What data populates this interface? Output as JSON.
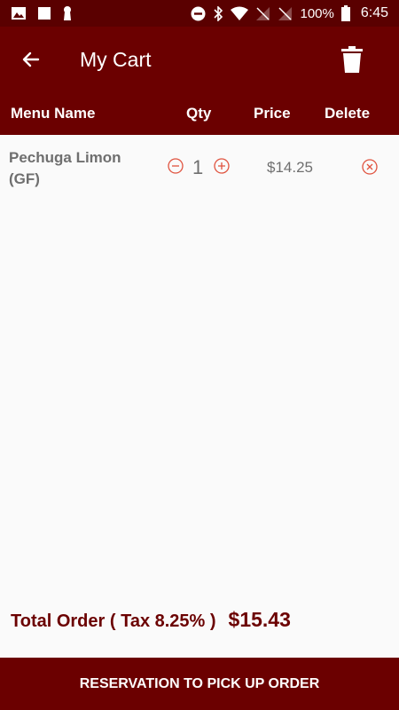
{
  "status_bar": {
    "battery": "100%",
    "time": "6:45",
    "icons": [
      "image-icon",
      "square-icon",
      "keyhole-icon",
      "dnd-icon",
      "bluetooth-icon",
      "wifi-icon",
      "no-signal-icon",
      "no-signal-icon",
      "battery-icon"
    ]
  },
  "app_bar": {
    "title": "My Cart",
    "back_icon": "arrow-left-icon",
    "trash_icon": "trash-icon"
  },
  "table": {
    "headers": {
      "name": "Menu Name",
      "qty": "Qty",
      "price": "Price",
      "delete": "Delete"
    },
    "rows": [
      {
        "name": "Pechuga Limon (GF)",
        "qty": "1",
        "price": "$14.25"
      }
    ]
  },
  "summary": {
    "label": "Total Order ( Tax 8.25% )",
    "value": "$15.43"
  },
  "footer": {
    "button_label": "RESERVATION TO PICK UP ORDER"
  },
  "colors": {
    "primary": "#6b0000",
    "status_bar": "#5a0000",
    "accent_icon": "#e0533f",
    "text_gray": "#6f6f6f"
  }
}
